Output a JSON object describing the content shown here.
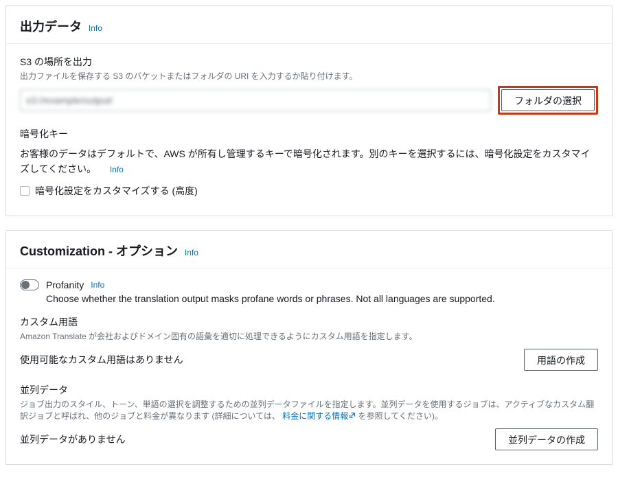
{
  "output": {
    "title": "出力データ",
    "info": "Info",
    "s3_label": "S3 の場所を出力",
    "s3_hint": "出力ファイルを保存する S3 のバケットまたはフォルダの URI を入力するか貼り付けます。",
    "s3_value": "s3://example/output/",
    "select_folder_btn": "フォルダの選択",
    "enc_label": "暗号化キー",
    "enc_desc": "お客様のデータはデフォルトで、AWS が所有し管理するキーで暗号化されます。別のキーを選択するには、暗号化設定をカスタマイズしてください。",
    "enc_info": "Info",
    "enc_checkbox": "暗号化設定をカスタマイズする (高度)"
  },
  "custom": {
    "title": "Customization - オプション",
    "info": "Info",
    "profanity_label": "Profanity",
    "profanity_info": "Info",
    "profanity_desc": "Choose whether the translation output masks profane words or phrases. Not all languages are supported.",
    "terms_label": "カスタム用語",
    "terms_hint": "Amazon Translate が会社およびドメイン固有の語彙を適切に処理できるようにカスタム用語を指定します。",
    "terms_empty": "使用可能なカスタム用語はありません",
    "terms_create_btn": "用語の作成",
    "parallel_label": "並列データ",
    "parallel_hint_pre": "ジョブ出力のスタイル、トーン、単語の選択を調整するための並列データファイルを指定します。並列データを使用するジョブは、アクティブなカスタム翻訳ジョブと呼ばれ、他のジョブと料金が異なります (詳細については、",
    "parallel_hint_link": "料金に関する情報",
    "parallel_hint_post": " を参照してください)。",
    "parallel_empty": "並列データがありません",
    "parallel_create_btn": "並列データの作成"
  }
}
